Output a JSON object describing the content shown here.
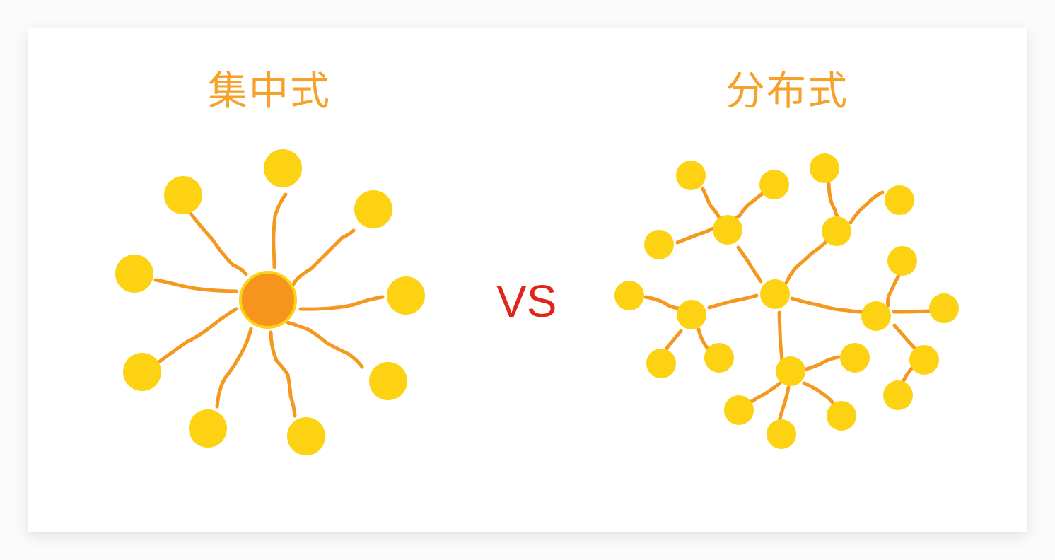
{
  "left": {
    "title": "集中式"
  },
  "vs_label": "VS",
  "right": {
    "title": "分布式"
  },
  "colors": {
    "node": "#fcd213",
    "hub": "#f6941e",
    "link": "#f5981f",
    "title": "#f6a129",
    "vs": "#e0261a"
  }
}
